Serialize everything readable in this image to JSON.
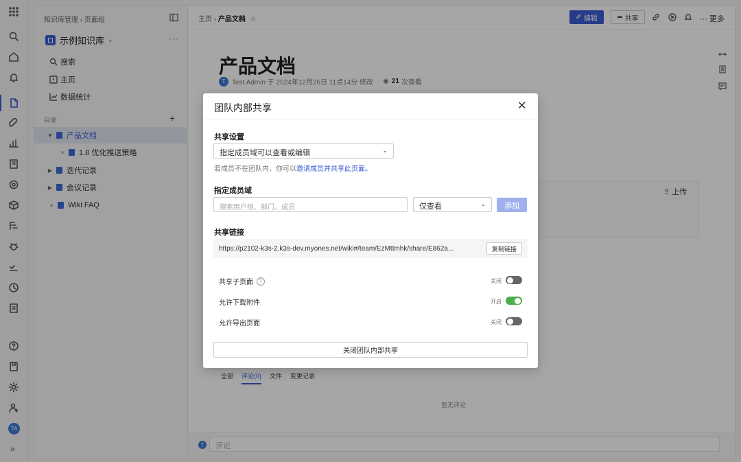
{
  "rail": {
    "avatar": "TA",
    "expand_glyph": "»"
  },
  "sidebar": {
    "breadcrumb": "知识库管理 › 页面组",
    "library_name": "示例知识库",
    "more": "···",
    "nav": [
      {
        "label": "搜索",
        "icon": "search-icon"
      },
      {
        "label": "主页",
        "icon": "home-icon"
      },
      {
        "label": "数据统计",
        "icon": "chart-icon"
      }
    ],
    "section_label": "目录",
    "add": "+",
    "tree": [
      {
        "label": "产品文档",
        "selected": true,
        "expanded": true,
        "level": 0
      },
      {
        "label": "1.8 优化推送策略",
        "level": 1
      },
      {
        "label": "迭代记录",
        "level": 0
      },
      {
        "label": "会议记录",
        "level": 0
      },
      {
        "label": "Wiki FAQ",
        "level": 0
      }
    ]
  },
  "topbar": {
    "crumb_home": "主页 ›",
    "crumb_current": "产品文档",
    "edit_label": "编辑",
    "share_label": "共享",
    "more_label": "··· 更多"
  },
  "doc": {
    "title": "产品文档",
    "meta_avatar": "T",
    "meta_text": "Test Admin 于 2024年12月26日 11点14分 修改",
    "views_count": "21",
    "views_label": "次查看",
    "upload_label": "上传"
  },
  "comments": {
    "tabs": [
      "全部",
      "评论(0)",
      "文件",
      "变更记录"
    ],
    "active_tab": 1,
    "empty": "暂无评论",
    "input_placeholder": "评论",
    "avatar": "T"
  },
  "modal": {
    "title": "团队内部共享",
    "close": "✕",
    "share_settings_label": "共享设置",
    "share_settings_value": "指定成员域可以查看或编辑",
    "hint_text": "若成员不在团队内，你可以",
    "hint_link": "邀请成员并共享此页面。",
    "domain_label": "指定成员域",
    "domain_placeholder": "搜索用户组、部门、成员",
    "permission_value": "仅查看",
    "add_label": "添加",
    "link_label": "共享链接",
    "link_url": "https://p2102-k3s-2.k3s-dev.myones.net/wiki#/team/EzMttmhk/share/E862a...",
    "copy_label": "复制链接",
    "options": [
      {
        "label": "共享子页面",
        "state": "关闭",
        "on": false,
        "help": true
      },
      {
        "label": "允许下载附件",
        "state": "开启",
        "on": true,
        "help": false
      },
      {
        "label": "允许导出页面",
        "state": "关闭",
        "on": false,
        "help": false
      }
    ],
    "help_glyph": "?",
    "close_share_label": "关闭团队内部共享"
  }
}
